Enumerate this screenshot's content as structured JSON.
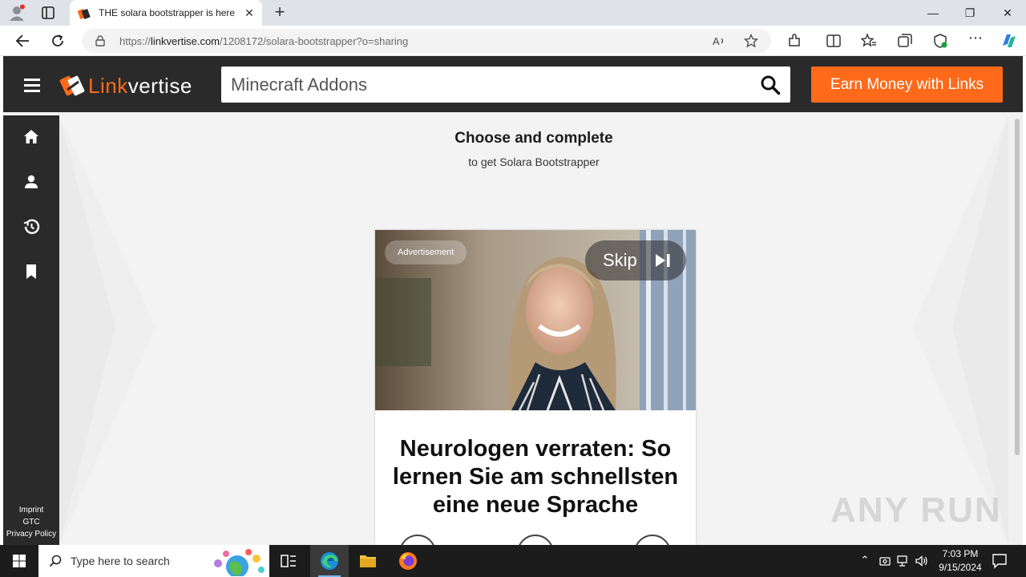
{
  "browser": {
    "tab_title": "THE solara bootstrapper is here, l",
    "url_host": "linkvertise.com",
    "url_prefix": "https://",
    "url_path": "/1208172/solara-bootstrapper?o=sharing"
  },
  "site": {
    "logo_link": "Link",
    "logo_vertise": "vertise",
    "search_value": "Minecraft Addons",
    "earn_button": "Earn Money with Links",
    "sidebar_links": [
      "Imprint",
      "GTC",
      "Privacy Policy"
    ]
  },
  "main": {
    "heading": "Choose and complete",
    "subheading": "to get Solara Bootstrapper"
  },
  "ad": {
    "badge": "Advertisement",
    "skip_label": "Skip",
    "headline": "Neurologen verraten: So lernen Sie am schnellsten eine neue Sprache"
  },
  "watermark": "ANY RUN",
  "taskbar": {
    "search_placeholder": "Type here to search",
    "time": "7:03 PM",
    "date": "9/15/2024"
  },
  "colors": {
    "brand_orange": "#ff6a1a",
    "header_dark": "#2a2a2a"
  }
}
